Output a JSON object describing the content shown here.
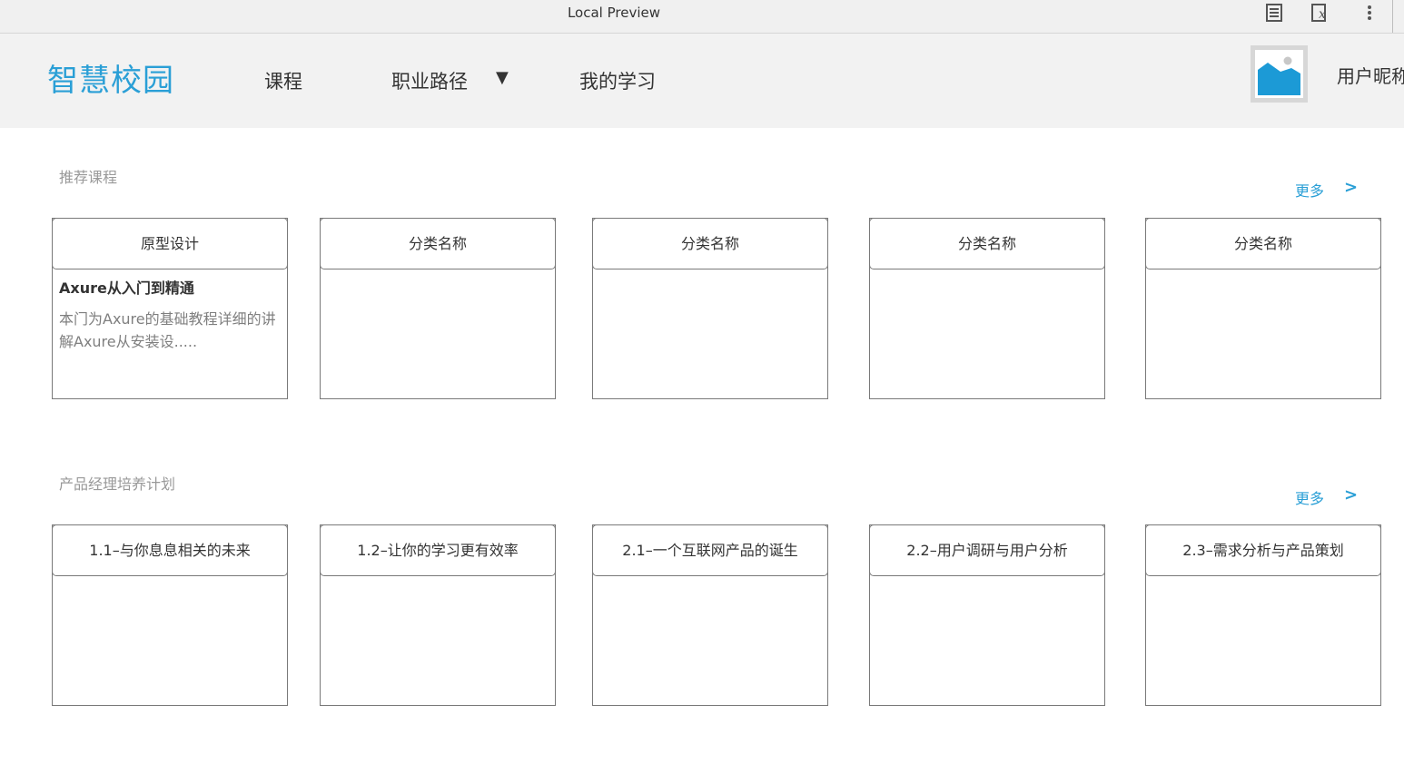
{
  "preview": {
    "title": "Local Preview"
  },
  "header": {
    "logo": "智慧校园",
    "nav": [
      {
        "label": "课程"
      },
      {
        "label": "职业路径"
      },
      {
        "label": "我的学习"
      }
    ],
    "caret": "▼",
    "username": "用户昵称"
  },
  "sections": [
    {
      "title": "推荐课程",
      "more_label": "更多",
      "more_arrow": ">",
      "cards": [
        {
          "label": "原型设计",
          "course_title": "Axure从入门到精通",
          "course_desc": "本门为Axure的基础教程详细的讲解Axure从安装设....."
        },
        {
          "label": "分类名称"
        },
        {
          "label": "分类名称"
        },
        {
          "label": "分类名称"
        },
        {
          "label": "分类名称"
        }
      ]
    },
    {
      "title": "产品经理培养计划",
      "more_label": "更多",
      "more_arrow": ">",
      "cards": [
        {
          "label": "1.1–与你息息相关的未来"
        },
        {
          "label": "1.2–让你的学习更有效率"
        },
        {
          "label": "2.1–一个互联网产品的诞生"
        },
        {
          "label": "2.2–用户调研与用户分析"
        },
        {
          "label": "2.3–需求分析与产品策划"
        }
      ]
    }
  ],
  "colors": {
    "accent": "#2a9fd6",
    "header_bg": "#f2f2f2",
    "muted": "#999999"
  }
}
